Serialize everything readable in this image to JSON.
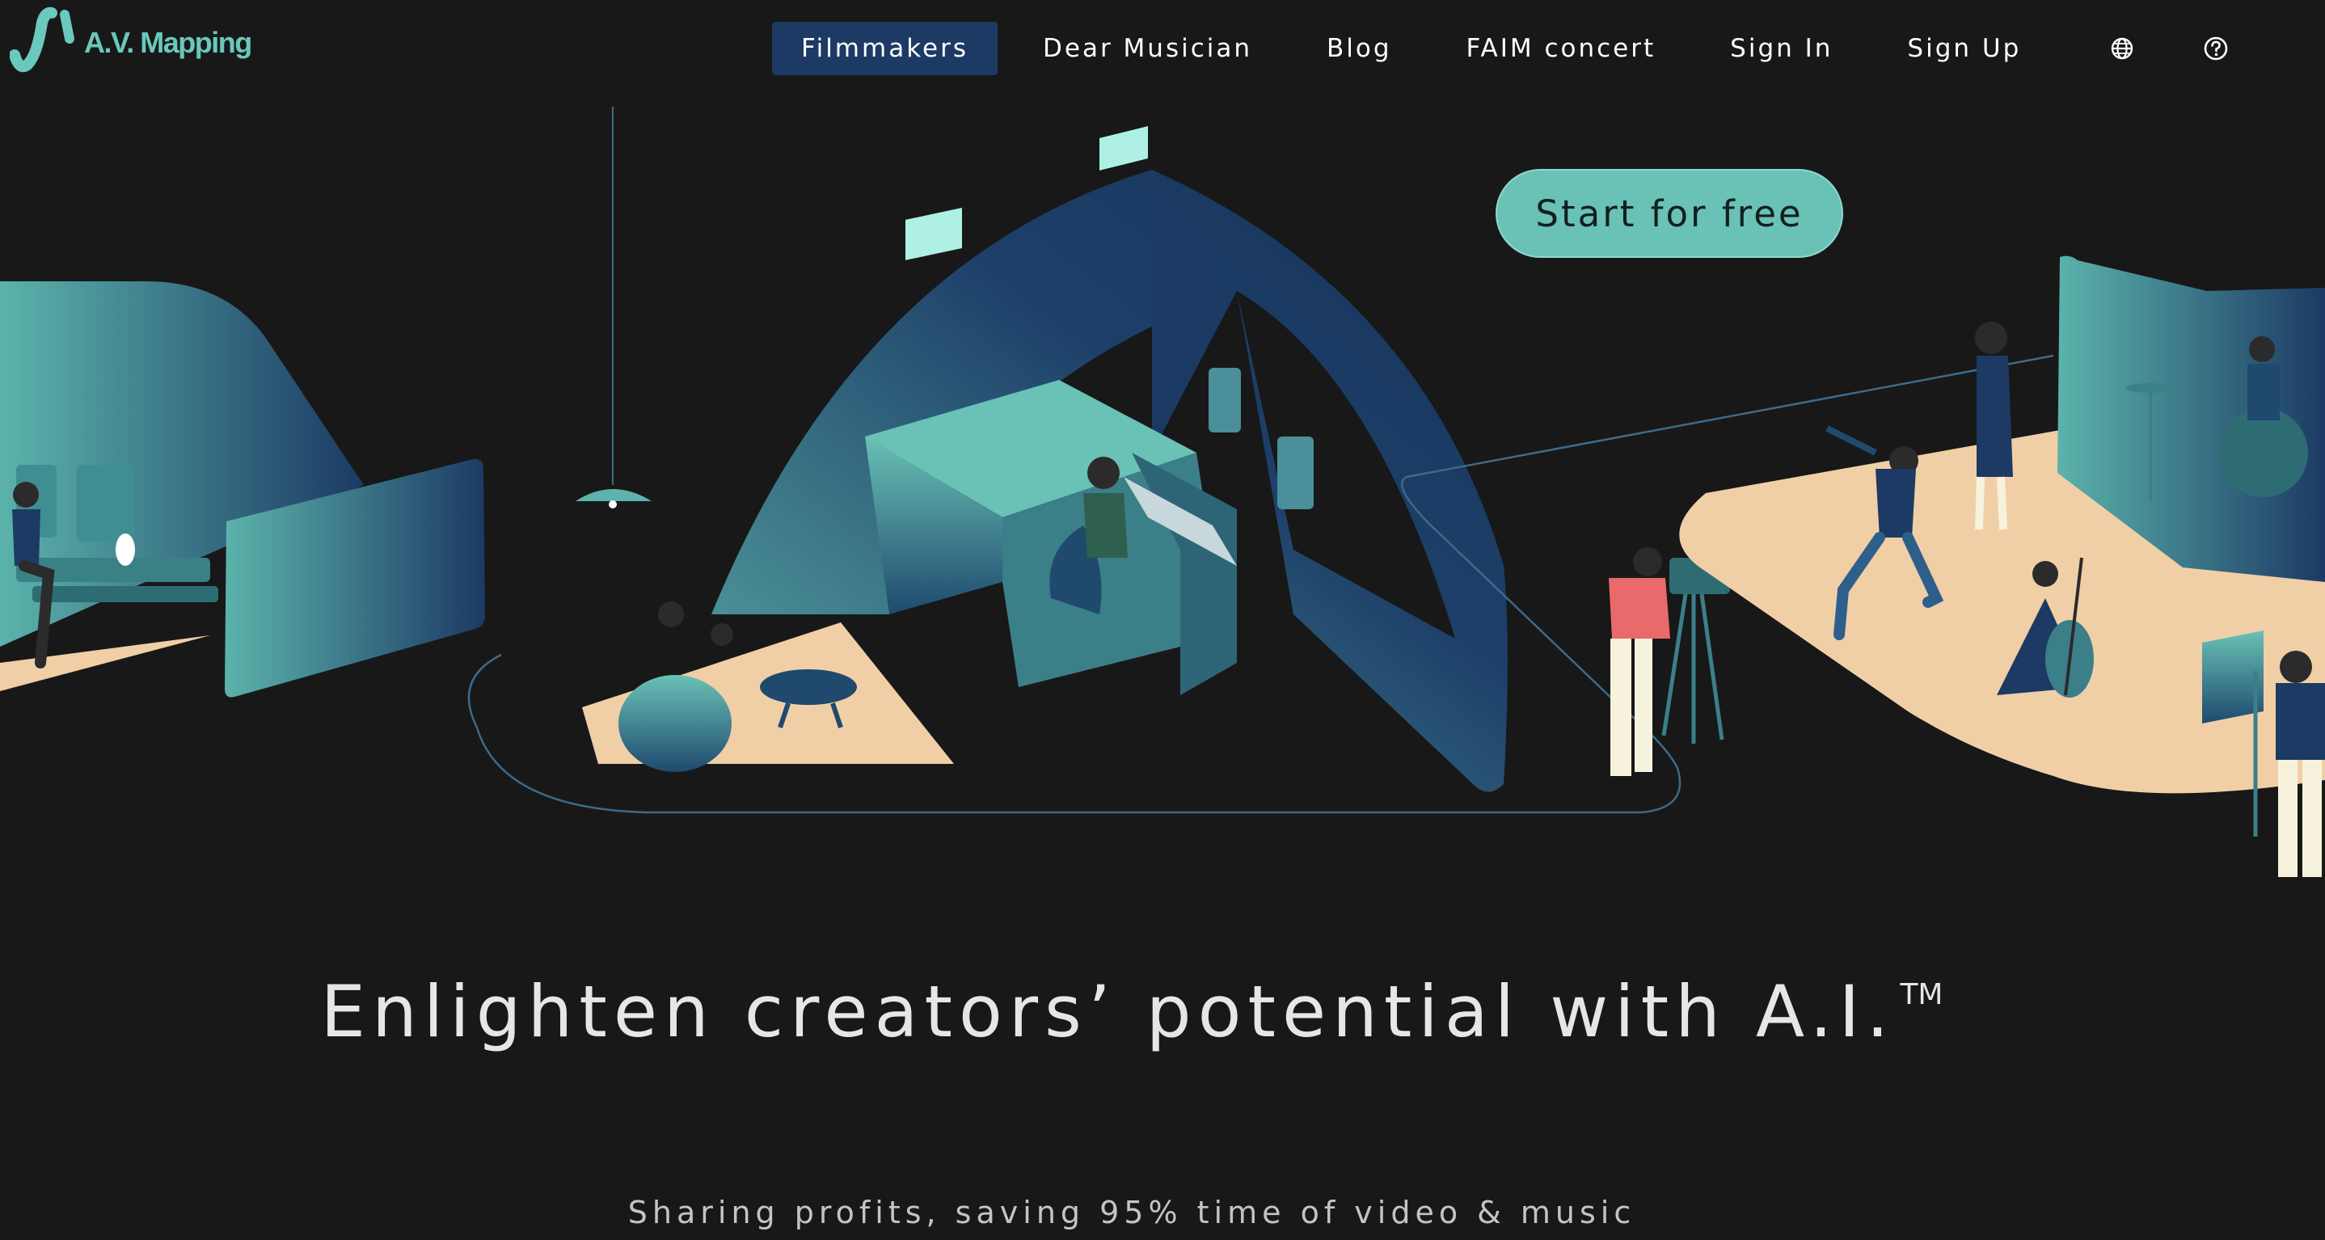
{
  "header": {
    "logo_text": "A.V. Mapping",
    "nav": [
      {
        "label": "Filmmakers",
        "active": true
      },
      {
        "label": "Dear Musician"
      },
      {
        "label": "Blog"
      },
      {
        "label": "FAIM concert"
      },
      {
        "label": "Sign In"
      },
      {
        "label": "Sign Up"
      }
    ]
  },
  "hero": {
    "cta_label": "Start for free",
    "headline": "Enlighten creators’ potential with A.I.",
    "headline_mark": "TM",
    "subline": "Sharing profits, saving 95% time of video & music"
  },
  "colors": {
    "background": "#181818",
    "accent": "#6ac1b6",
    "active_nav": "#1c3a64",
    "teal_dark": "#1c3a64",
    "sand": "#f1cfa6"
  },
  "icons": [
    "globe-icon",
    "help-icon"
  ]
}
